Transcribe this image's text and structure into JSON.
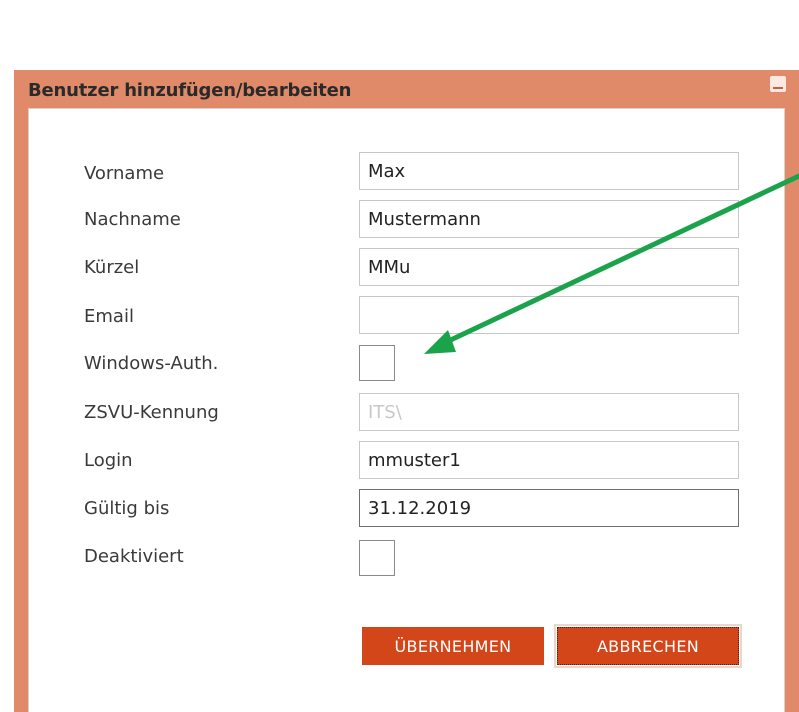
{
  "dialog": {
    "title": "Benutzer hinzufügen/bearbeiten",
    "minimize_icon": "minimize-icon"
  },
  "form": {
    "vorname_label": "Vorname",
    "vorname_value": "Max",
    "nachname_label": "Nachname",
    "nachname_value": "Mustermann",
    "kuerzel_label": "Kürzel",
    "kuerzel_value": "MMu",
    "email_label": "Email",
    "email_value": "",
    "windows_auth_label": "Windows-Auth.",
    "windows_auth_checked": false,
    "zsvu_label": "ZSVU-Kennung",
    "zsvu_value": "ITS\\",
    "login_label": "Login",
    "login_value": "mmuster1",
    "gueltig_label": "Gültig bis",
    "gueltig_value": "31.12.2019",
    "deaktiviert_label": "Deaktiviert",
    "deaktiviert_checked": false
  },
  "buttons": {
    "apply_label": "ÜBERNEHMEN",
    "cancel_label": "ABBRECHEN"
  },
  "colors": {
    "frame": "#e08a6a",
    "button": "#d2461a",
    "annotation_arrow": "#1aa34a"
  },
  "annotation": {
    "icon": "arrow-icon"
  }
}
